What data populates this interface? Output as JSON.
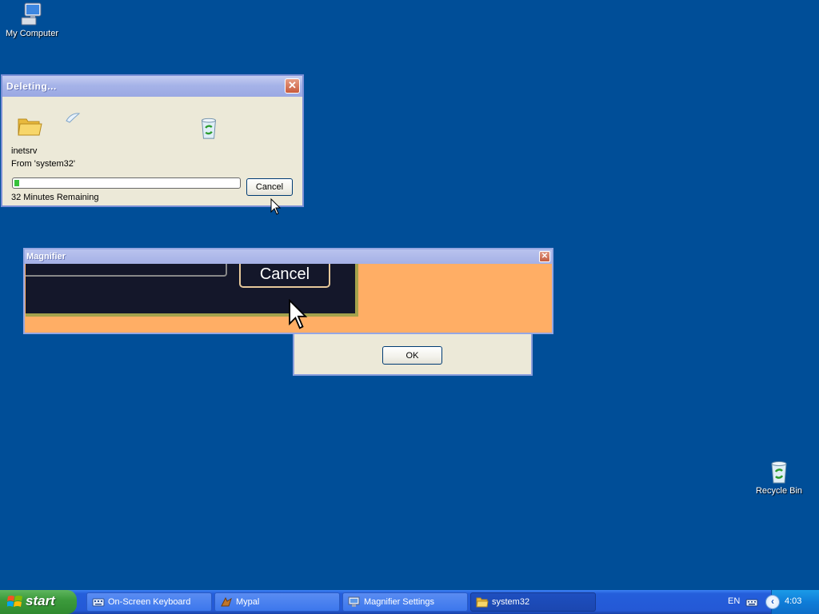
{
  "desktop": {
    "icons": [
      {
        "label": "My Computer",
        "icon": "my-computer-icon"
      },
      {
        "label": "Recycle Bin",
        "icon": "recycle-bin-icon"
      }
    ]
  },
  "delete_dialog": {
    "title": "Deleting...",
    "item_name": "inetsrv",
    "source": "From 'system32'",
    "progress_percent": 2,
    "time_remaining": "32 Minutes Remaining",
    "cancel_label": "Cancel"
  },
  "magnifier": {
    "title": "Magnifier",
    "magnified_cancel_label": "Cancel"
  },
  "background_dialog": {
    "ok_label": "OK"
  },
  "taskbar": {
    "start_label": "start",
    "tasks": [
      {
        "label": "On-Screen Keyboard",
        "icon": "keyboard-icon"
      },
      {
        "label": "Mypal",
        "icon": "mypal-icon"
      },
      {
        "label": "Magnifier Settings",
        "icon": "magnifier-settings-icon"
      },
      {
        "label": "system32",
        "icon": "folder-icon",
        "active": true
      }
    ],
    "tray": {
      "language": "EN",
      "clock": "4:03"
    }
  },
  "colors": {
    "desktop": "#004e98",
    "taskbar": "#245edb",
    "magnifier_bg": "#ffae65",
    "start_green": "#3c9b3c"
  }
}
